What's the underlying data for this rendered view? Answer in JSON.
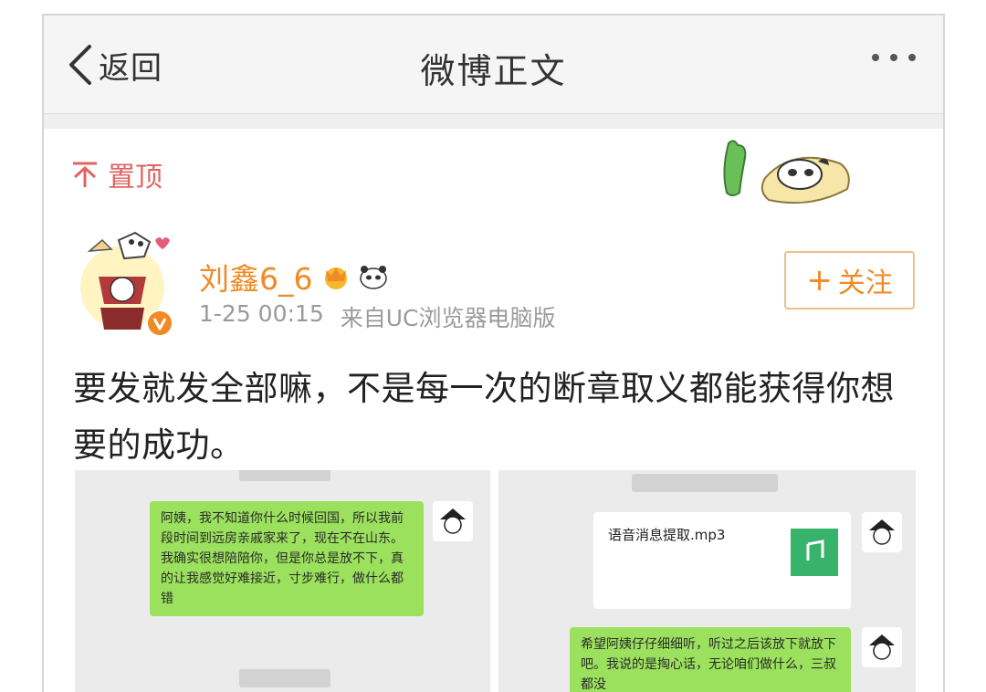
{
  "nav": {
    "back_label": "返回",
    "title": "微博正文"
  },
  "post": {
    "pin_label": "置顶",
    "username": "刘鑫6_6",
    "timestamp": "1-25 00:15",
    "source": "来自UC浏览器电脑版",
    "follow_label": "关注",
    "content": "要发就发全部嘛，不是每一次的断章取义都能获得你想要的成功。"
  },
  "images": {
    "left": {
      "time_top": "",
      "message": "阿姨，我不知道你什么时候回国，所以我前段时间到远房亲戚家来了，现在不在山东。我确实很想陪陪你，但是你总是放不下，真的让我感觉好难接近，寸步难行，做什么都错",
      "time_bottom": ""
    },
    "right": {
      "time_top": "",
      "file_name": "语音消息提取.mp3",
      "file_size": "",
      "file_source": "",
      "message": "希望阿姨仔仔细细听，听过之后该放下就放下吧。我说的是掏心话，无论咱们做什么，三叔都没"
    }
  },
  "colors": {
    "accent": "#f08a24",
    "pin": "#e06363",
    "bubble": "#9be15d",
    "music": "#37b36b"
  },
  "icons": {
    "back": "chevron-left-icon",
    "more": "more-dots-icon",
    "pin": "pin-top-icon",
    "verified": "verified-v-icon",
    "music": "music-note-icon"
  }
}
